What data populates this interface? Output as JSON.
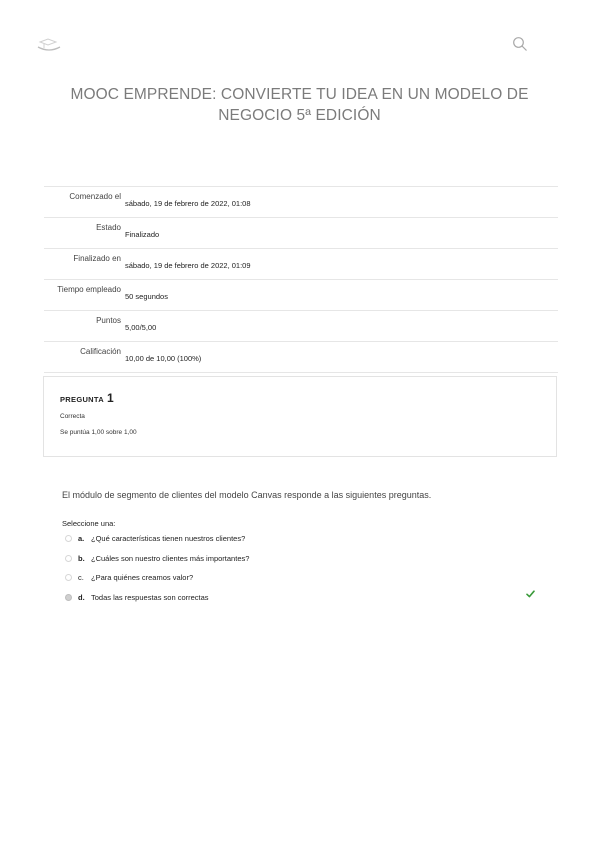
{
  "header": {
    "logo_icon": "moodle-hat-logo",
    "search_icon": "search-icon"
  },
  "course": {
    "title": "MOOC EMPRENDE: CONVIERTE TU IDEA EN UN MODELO DE NEGOCIO 5ª EDICIÓN"
  },
  "summary": {
    "rows": [
      {
        "label": "Comenzado el",
        "value": "sábado, 19 de febrero de 2022, 01:08"
      },
      {
        "label": "Estado",
        "value": "Finalizado"
      },
      {
        "label": "Finalizado en",
        "value": "sábado, 19 de febrero de 2022, 01:09"
      },
      {
        "label": "Tiempo empleado",
        "value": "50 segundos"
      },
      {
        "label": "Puntos",
        "value": "5,00/5,00"
      },
      {
        "label": "Calificación",
        "value": "10,00 de 10,00 (100%)"
      }
    ]
  },
  "question": {
    "label": "PREGUNTA",
    "number": "1",
    "state": "Correcta",
    "grade": "Se puntúa 1,00 sobre 1,00",
    "text": "El módulo de segmento de clientes del modelo Canvas responde a las siguientes preguntas.",
    "prompt": "Seleccione una:",
    "answers": [
      {
        "letter": "a.",
        "text": "¿Qué características tienen nuestros clientes?"
      },
      {
        "letter": "b.",
        "text": "¿Cuáles son nuestro clientes más importantes?"
      },
      {
        "letter": "c.",
        "text": "¿Para quiénes creamos valor?"
      },
      {
        "letter": "d.",
        "text": "Todas las respuestas son correctas"
      }
    ],
    "selected_answer": "d.",
    "correct_icon": "check-icon",
    "correct_color": "#3a9a3a"
  }
}
